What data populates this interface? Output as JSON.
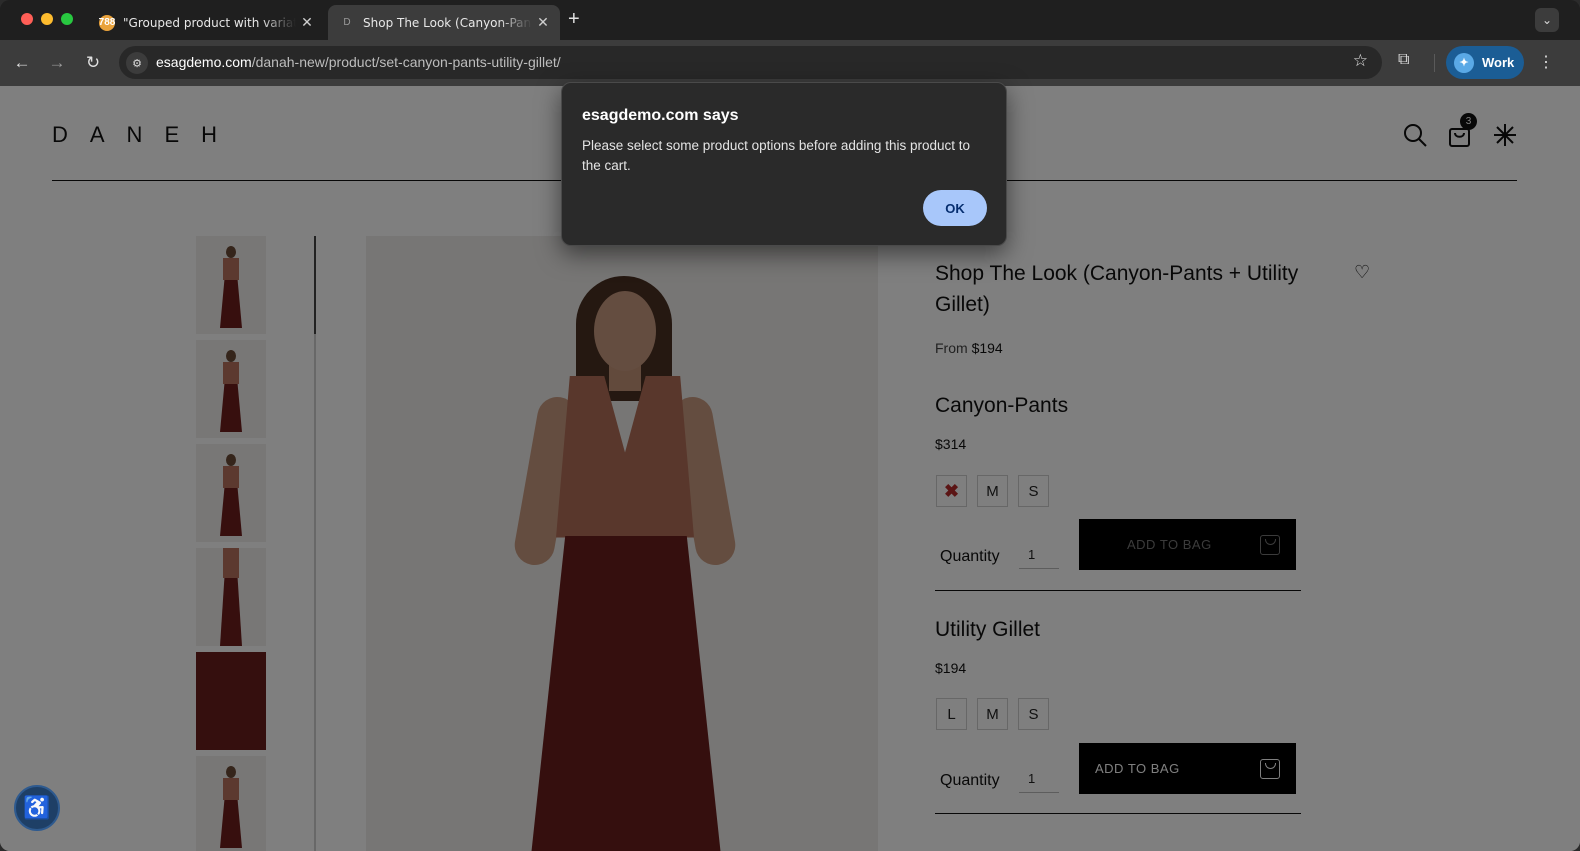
{
  "browser": {
    "tabs": [
      {
        "title": "\"Grouped product with variati",
        "favicon": "orange-badge",
        "favicon_text": "788"
      },
      {
        "title": "Shop The Look (Canyon-Pant",
        "favicon": "d-letter",
        "favicon_text": "D"
      }
    ],
    "url_host": "esagdemo.com",
    "url_path": "/danah-new/product/set-canyon-pants-utility-gillet/",
    "profile_label": "Work"
  },
  "site": {
    "logo": "DANEH",
    "cart_count": "3"
  },
  "product": {
    "title": "Shop The Look (Canyon-Pants + Utility Gillet)",
    "from_label": "From",
    "from_price": "$194",
    "items": [
      {
        "name": "Canyon-Pants",
        "price": "$314",
        "sizes": [
          "✖",
          "M",
          "S"
        ],
        "quantity_label": "Quantity",
        "quantity": "1",
        "button_label": "ADD TO BAG"
      },
      {
        "name": "Utility Gillet",
        "price": "$194",
        "sizes": [
          "L",
          "M",
          "S"
        ],
        "quantity_label": "Quantity",
        "quantity": "1",
        "button_label": "ADD TO BAG"
      }
    ]
  },
  "dialog": {
    "title": "esagdemo.com says",
    "message": "Please select some product options before adding this product to the cart.",
    "ok_label": "OK"
  },
  "colors": {
    "accent_ok": "#a8c7fa",
    "profile": "#1b5d95",
    "pants": "#6b1f1d"
  }
}
